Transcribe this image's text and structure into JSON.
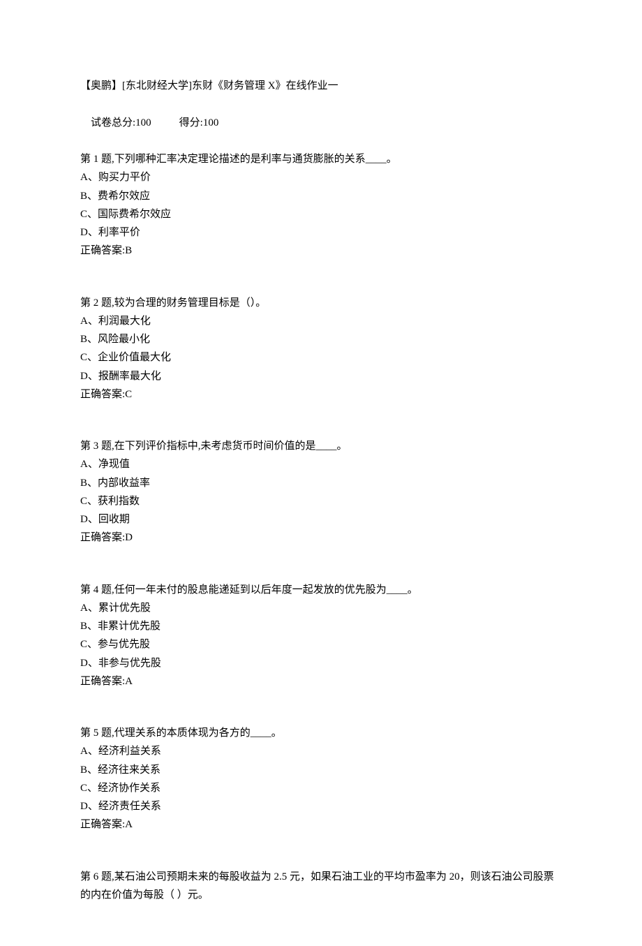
{
  "header": {
    "title": "【奥鹏】[东北财经大学]东财《财务管理 X》在线作业一",
    "total_label": "试卷总分:",
    "total_value": "100",
    "score_label": "得分:",
    "score_value": "100"
  },
  "questions": [
    {
      "prompt": "第 1 题,下列哪种汇率决定理论描述的是利率与通货膨胀的关系____。",
      "options": [
        "A、购买力平价",
        "B、费希尔效应",
        "C、国际费希尔效应",
        "D、利率平价"
      ],
      "answer_label": "正确答案:",
      "answer": "B"
    },
    {
      "prompt": "第 2 题,较为合理的财务管理目标是（）。",
      "options": [
        "A、利润最大化",
        "B、风险最小化",
        "C、企业价值最大化",
        "D、报酬率最大化"
      ],
      "answer_label": "正确答案:",
      "answer": "C"
    },
    {
      "prompt": "第 3 题,在下列评价指标中,未考虑货币时间价值的是____。",
      "options": [
        "A、净现值",
        "B、内部收益率",
        "C、获利指数",
        "D、回收期"
      ],
      "answer_label": "正确答案:",
      "answer": "D"
    },
    {
      "prompt": "第 4 题,任何一年未付的股息能递延到以后年度一起发放的优先股为____。",
      "options": [
        "A、累计优先股",
        "B、非累计优先股",
        "C、参与优先股",
        "D、非参与优先股"
      ],
      "answer_label": "正确答案:",
      "answer": "A"
    },
    {
      "prompt": "第 5 题,代理关系的本质体现为各方的____。",
      "options": [
        "A、经济利益关系",
        "B、经济往来关系",
        "C、经济协作关系",
        "D、经济责任关系"
      ],
      "answer_label": "正确答案:",
      "answer": "A"
    },
    {
      "prompt": "第 6 题,某石油公司预期未来的每股收益为 2.5 元，如果石油工业的平均市盈率为 20，则该石油公司股票的内在价值为每股（ ）元。",
      "options": [],
      "answer_label": "",
      "answer": ""
    }
  ]
}
